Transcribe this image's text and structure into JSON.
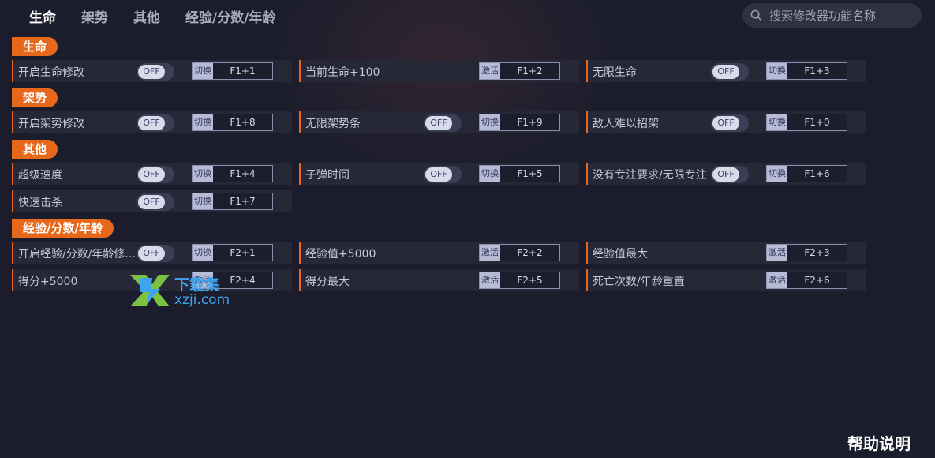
{
  "tabs": [
    "生命",
    "架势",
    "其他",
    "经验/分数/年龄"
  ],
  "search": {
    "placeholder": "搜索修改器功能名称",
    "icon": "search-icon"
  },
  "toggle_text": "OFF",
  "sections": [
    {
      "title": "生命",
      "items": [
        {
          "label": "开启生命修改",
          "type": "toggle",
          "kind": "切换",
          "hotkey": "F1+1"
        },
        {
          "label": "当前生命+100",
          "type": "button",
          "kind": "激活",
          "hotkey": "F1+2"
        },
        {
          "label": "无限生命",
          "type": "toggle",
          "kind": "切换",
          "hotkey": "F1+3"
        }
      ]
    },
    {
      "title": "架势",
      "items": [
        {
          "label": "开启架势修改",
          "type": "toggle",
          "kind": "切换",
          "hotkey": "F1+8"
        },
        {
          "label": "无限架势条",
          "type": "toggle",
          "kind": "切换",
          "hotkey": "F1+9"
        },
        {
          "label": "敌人难以招架",
          "type": "toggle",
          "kind": "切换",
          "hotkey": "F1+0"
        }
      ]
    },
    {
      "title": "其他",
      "items": [
        {
          "label": "超级速度",
          "type": "toggle",
          "kind": "切换",
          "hotkey": "F1+4"
        },
        {
          "label": "子弹时间",
          "type": "toggle",
          "kind": "切换",
          "hotkey": "F1+5"
        },
        {
          "label": "没有专注要求/无限专注",
          "type": "toggle",
          "kind": "切换",
          "hotkey": "F1+6"
        },
        {
          "label": "快速击杀",
          "type": "toggle",
          "kind": "切换",
          "hotkey": "F1+7"
        }
      ]
    },
    {
      "title": "经验/分数/年龄",
      "items": [
        {
          "label": "开启经验/分数/年龄修...",
          "type": "toggle",
          "kind": "切换",
          "hotkey": "F2+1"
        },
        {
          "label": "经验值+5000",
          "type": "button",
          "kind": "激活",
          "hotkey": "F2+2"
        },
        {
          "label": "经验值最大",
          "type": "button",
          "kind": "激活",
          "hotkey": "F2+3"
        },
        {
          "label": "得分+5000",
          "type": "button",
          "kind": "激活",
          "hotkey": "F2+4"
        },
        {
          "label": "得分最大",
          "type": "button",
          "kind": "激活",
          "hotkey": "F2+5"
        },
        {
          "label": "死亡次数/年龄重置",
          "type": "button",
          "kind": "激活",
          "hotkey": "F2+6"
        }
      ]
    }
  ],
  "watermark": {
    "line1": "下载集",
    "line2": "xzji.com"
  },
  "help_label": "帮助说明",
  "colors": {
    "accent": "#e8681b",
    "background": "#1b1d2c",
    "row": "#262838"
  }
}
